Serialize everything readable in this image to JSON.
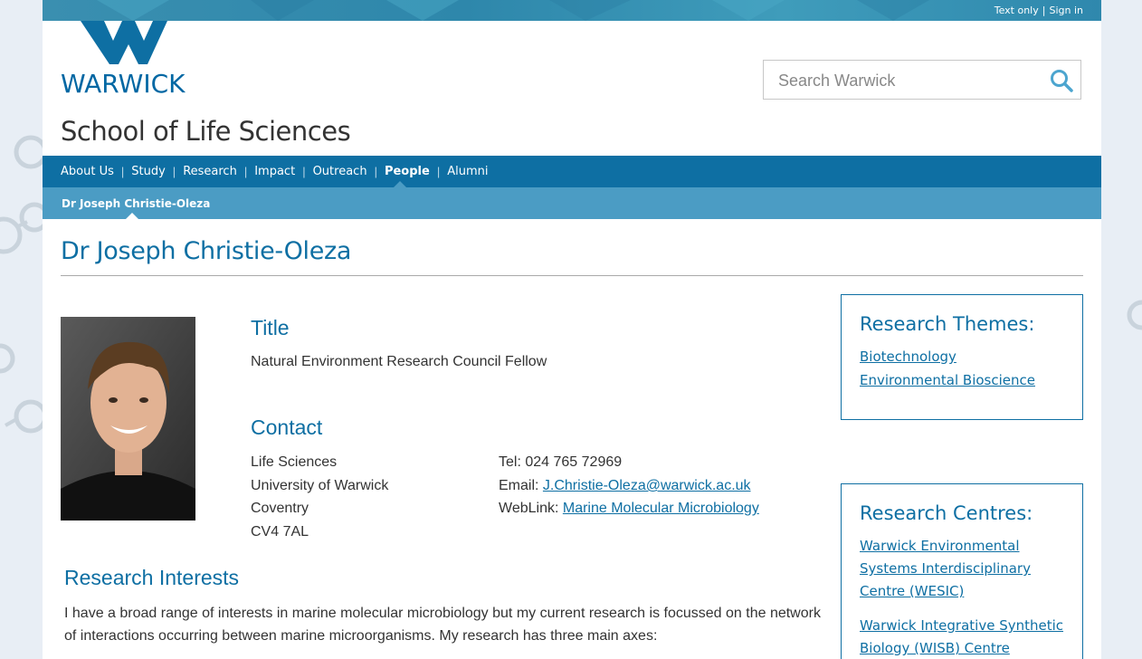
{
  "utility": {
    "text_only": "Text only",
    "sign_in": "Sign in"
  },
  "logo": {
    "text": "WARWICK"
  },
  "search": {
    "placeholder": "Search Warwick"
  },
  "site_title": "School of Life Sciences",
  "nav": {
    "items": [
      "About Us",
      "Study",
      "Research",
      "Impact",
      "Outreach",
      "People",
      "Alumni"
    ],
    "active": "People"
  },
  "subnav": {
    "current": "Dr Joseph Christie-Oleza"
  },
  "page_title": "Dr Joseph Christie-Oleza",
  "profile": {
    "title_heading": "Title",
    "title_value": "Natural Environment Research Council Fellow",
    "contact_heading": "Contact",
    "address": [
      "Life Sciences",
      "University of Warwick",
      "Coventry",
      "CV4 7AL"
    ],
    "tel_label": "Tel:",
    "tel": "024 765 72969",
    "email_label": "Email:",
    "email": "J.Christie-Oleza@warwick.ac.uk",
    "weblink_label": "WebLink:",
    "weblink": "Marine Molecular Microbiology"
  },
  "research_interests": {
    "heading": "Research Interests",
    "text": "I have a broad range of interests in marine molecular microbiology but my current research is focussed on the network of interactions occurring between marine microorganisms. My research has three main axes:"
  },
  "research_themes": {
    "heading": "Research Themes:",
    "links": [
      "Biotechnology",
      "Environmental Bioscience"
    ]
  },
  "research_centres": {
    "heading": "Research Centres:",
    "links": [
      "Warwick Environmental Systems Interdisciplinary Centre (WESIC)",
      "Warwick Integrative Synthetic Biology (WISB) Centre"
    ]
  },
  "colors": {
    "brand_blue": "#0e6fa3",
    "subnav_blue": "#4b9cc4",
    "utility_teal": "#2e87ab"
  }
}
